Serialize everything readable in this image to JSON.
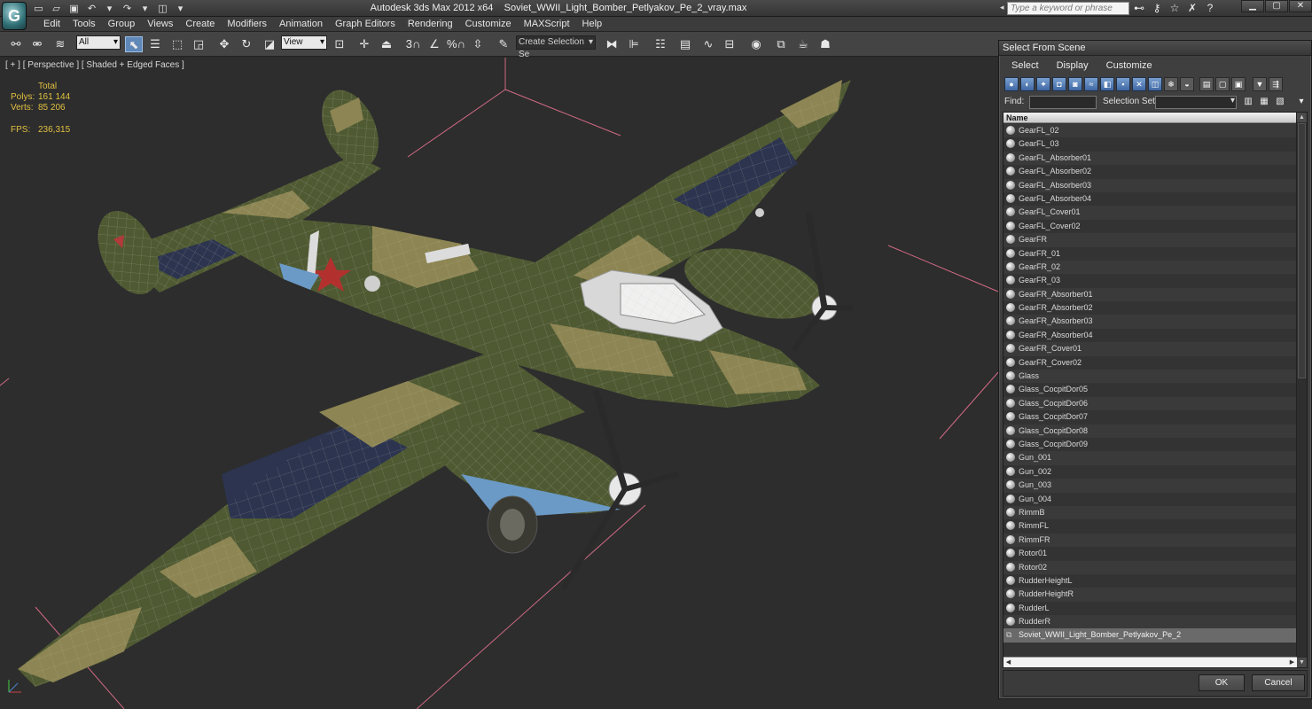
{
  "titlebar": {
    "app_name": "Autodesk 3ds Max  2012 x64",
    "file_name": "Soviet_WWII_Light_Bomber_Petlyakov_Pe_2_vray.max",
    "search_placeholder": "Type a keyword or phrase",
    "logo_glyph": "G"
  },
  "menu": [
    "Edit",
    "Tools",
    "Group",
    "Views",
    "Create",
    "Modifiers",
    "Animation",
    "Graph Editors",
    "Rendering",
    "Customize",
    "MAXScript",
    "Help"
  ],
  "toolbar": {
    "selection_filter": "All",
    "reference_coord": "View",
    "named_selection_placeholder": "Create Selection Se",
    "snap_3": "3",
    "percent_snap": "%"
  },
  "viewport": {
    "label": "[ + ] [ Perspective ] [ Shaded + Edged Faces ]",
    "stats": {
      "header": "Total",
      "polys_label": "Polys:",
      "polys_value": "161 144",
      "verts_label": "Verts:",
      "verts_value": "85 206",
      "fps_label": "FPS:",
      "fps_value": "236,315"
    }
  },
  "dialog": {
    "title": "Select From Scene",
    "menu": [
      "Select",
      "Display",
      "Customize"
    ],
    "find_label": "Find:",
    "find_value": "",
    "selection_set_label": "Selection Set:",
    "column_header": "Name",
    "items": [
      "GearFL_02",
      "GearFL_03",
      "GearFL_Absorber01",
      "GearFL_Absorber02",
      "GearFL_Absorber03",
      "GearFL_Absorber04",
      "GearFL_Cover01",
      "GearFL_Cover02",
      "GearFR",
      "GearFR_01",
      "GearFR_02",
      "GearFR_03",
      "GearFR_Absorber01",
      "GearFR_Absorber02",
      "GearFR_Absorber03",
      "GearFR_Absorber04",
      "GearFR_Cover01",
      "GearFR_Cover02",
      "Glass",
      "Glass_CocpitDor05",
      "Glass_CocpitDor06",
      "Glass_CocpitDor07",
      "Glass_CocpitDor08",
      "Glass_CocpitDor09",
      "Gun_001",
      "Gun_002",
      "Gun_003",
      "Gun_004",
      "RimmB",
      "RimmFL",
      "RimmFR",
      "Rotor01",
      "Rotor02",
      "RudderHeightL",
      "RudderHeightR",
      "RudderL",
      "RudderR"
    ],
    "group_item": "Soviet_WWII_Light_Bomber_Petlyakov_Pe_2",
    "ok_label": "OK",
    "cancel_label": "Cancel"
  },
  "colors": {
    "accent_blue": "#5f87b8",
    "stats_yellow": "#e0c040",
    "grid_pink": "#d06a84",
    "camo_green": "#4f5a33",
    "camo_tan": "#8d8553",
    "camo_navy": "#2c3450"
  }
}
